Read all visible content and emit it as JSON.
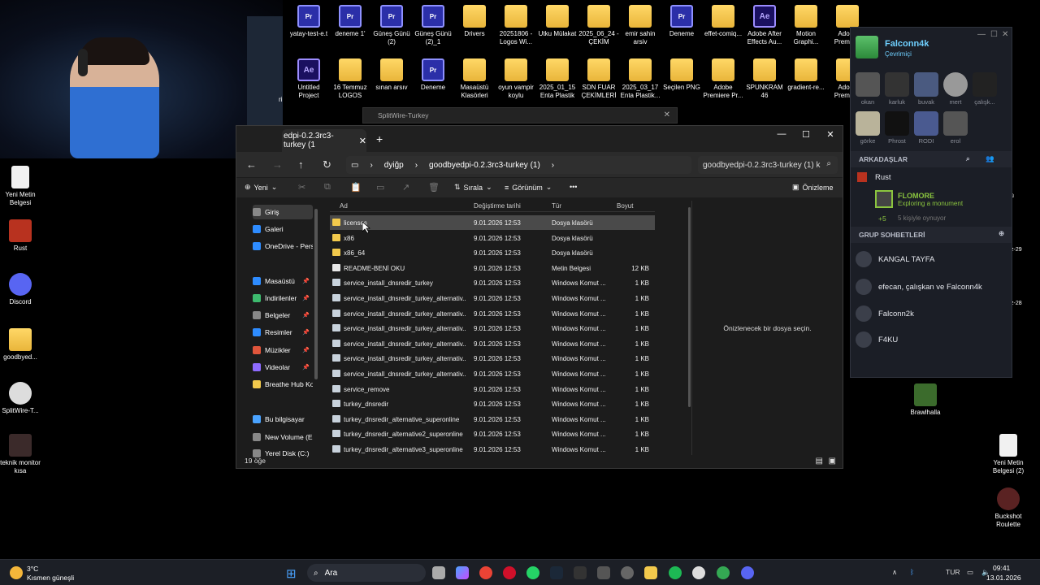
{
  "colors": {
    "folder": "#f2c94c",
    "accent": "#4aa3ff",
    "steam_bg": "#1b1e26",
    "discord": "#5865f2",
    "selected_row": "#4a4a4a"
  },
  "desktop_left": [
    {
      "label": "Yeni Metin Belgesi",
      "icon": "text-doc-icon"
    },
    {
      "label": "Rust",
      "icon": "rust-icon"
    },
    {
      "label": "Discord",
      "icon": "discord-icon"
    },
    {
      "label": "goodbyed...",
      "icon": "folder-icon"
    },
    {
      "label": "SplitWire-T...",
      "icon": "splitwire-icon"
    },
    {
      "label": "teknik monitor kısa",
      "icon": "video-icon"
    }
  ],
  "desktop_top_row1": [
    "yatay-test-e.t",
    "deneme 1'",
    "Güneş Günü (2)",
    "Güneş Günü (2)_1",
    "Drivers",
    "20251806 -Logos Wi...",
    "Utku Mülakat",
    "2025_06_24 - ÇEKİM",
    "emir sahin arsiv",
    "Deneme",
    "effet-comiq...",
    "Adobe After Effects Au...",
    "Motion Graphi...",
    "Adobe Premiere"
  ],
  "desktop_top_row2": [
    "Untitled Project",
    "16 Temmuz LOGOS",
    "sınan arsıv",
    "Deneme",
    "Masaüstü Klasörleri",
    "oyun vampir koylu",
    "2025_01_15 Enta Plastik",
    "SDN FUAR ÇEKİMLERİ",
    "2025_03_17 Enta Plastik...",
    "Seçilen PNG",
    "Adobe Premiere Pr...",
    "SPUNKRAM 46",
    "gradient-re...",
    "Adobe Premiere"
  ],
  "desktop_right": [
    {
      "label": "Brawlhalla"
    },
    {
      "label": "Yeni Metin Belgesi (2)"
    },
    {
      "label": "Buckshot Roulette"
    }
  ],
  "right_edge_labels": [
    "ü",
    "z-29",
    "z-28"
  ],
  "partial_label": "ri",
  "splitwire": {
    "title": "SplitWire-Turkey"
  },
  "explorer": {
    "tab_title": "edpi-0.2.3rc3-turkey (1",
    "tab_close": "✕",
    "new_tab": "+",
    "breadcrumb": [
      "dyiğp",
      "goodbyedpi-0.2.3rc3-turkey (1)"
    ],
    "search_placeholder": "goodbyedpi-0.2.3rc3-turkey (1) k",
    "toolbar": {
      "new": "Yeni",
      "sort": "Sırala",
      "view": "Görünüm",
      "more": "•••",
      "preview": "Önizleme"
    },
    "sidebar": [
      {
        "label": "Giriş",
        "pin": ""
      },
      {
        "label": "Galeri",
        "pin": ""
      },
      {
        "label": "OneDrive - Perso",
        "pin": ""
      },
      {
        "label": "Masaüstü",
        "pin": "📌"
      },
      {
        "label": "İndirilenler",
        "pin": "📌"
      },
      {
        "label": "Belgeler",
        "pin": "📌"
      },
      {
        "label": "Resimler",
        "pin": "📌"
      },
      {
        "label": "Müzikler",
        "pin": "📌"
      },
      {
        "label": "Videolar",
        "pin": "📌"
      },
      {
        "label": "Breathe Hub Koı",
        "pin": ""
      },
      {
        "label": "Bu bilgisayar",
        "pin": ""
      },
      {
        "label": "New Volume (E",
        "pin": ""
      },
      {
        "label": "Yerel Disk (C:)",
        "pin": ""
      }
    ],
    "columns": [
      "Ad",
      "Değiştirme tarihi",
      "Tür",
      "Boyut"
    ],
    "files": [
      {
        "name": "licenses",
        "date": "9.01.2026 12:53",
        "type": "Dosya klasörü",
        "size": "",
        "kind": "folder"
      },
      {
        "name": "x86",
        "date": "9.01.2026 12:53",
        "type": "Dosya klasörü",
        "size": "",
        "kind": "folder"
      },
      {
        "name": "x86_64",
        "date": "9.01.2026 12:53",
        "type": "Dosya klasörü",
        "size": "",
        "kind": "folder"
      },
      {
        "name": "README-BENİ OKU",
        "date": "9.01.2026 12:53",
        "type": "Metin Belgesi",
        "size": "12 KB",
        "kind": "text"
      },
      {
        "name": "service_install_dnsredir_turkey",
        "date": "9.01.2026 12:53",
        "type": "Windows Komut ...",
        "size": "1 KB",
        "kind": "cmd"
      },
      {
        "name": "service_install_dnsredir_turkey_alternativ...",
        "date": "9.01.2026 12:53",
        "type": "Windows Komut ...",
        "size": "1 KB",
        "kind": "cmd"
      },
      {
        "name": "service_install_dnsredir_turkey_alternativ...",
        "date": "9.01.2026 12:53",
        "type": "Windows Komut ...",
        "size": "1 KB",
        "kind": "cmd"
      },
      {
        "name": "service_install_dnsredir_turkey_alternativ...",
        "date": "9.01.2026 12:53",
        "type": "Windows Komut ...",
        "size": "1 KB",
        "kind": "cmd"
      },
      {
        "name": "service_install_dnsredir_turkey_alternativ...",
        "date": "9.01.2026 12:53",
        "type": "Windows Komut ...",
        "size": "1 KB",
        "kind": "cmd"
      },
      {
        "name": "service_install_dnsredir_turkey_alternativ...",
        "date": "9.01.2026 12:53",
        "type": "Windows Komut ...",
        "size": "1 KB",
        "kind": "cmd"
      },
      {
        "name": "service_install_dnsredir_turkey_alternativ...",
        "date": "9.01.2026 12:53",
        "type": "Windows Komut ...",
        "size": "1 KB",
        "kind": "cmd"
      },
      {
        "name": "service_remove",
        "date": "9.01.2026 12:53",
        "type": "Windows Komut ...",
        "size": "1 KB",
        "kind": "cmd"
      },
      {
        "name": "turkey_dnsredir",
        "date": "9.01.2026 12:53",
        "type": "Windows Komut ...",
        "size": "1 KB",
        "kind": "cmd"
      },
      {
        "name": "turkey_dnsredir_alternative_superonline",
        "date": "9.01.2026 12:53",
        "type": "Windows Komut ...",
        "size": "1 KB",
        "kind": "cmd"
      },
      {
        "name": "turkey_dnsredir_alternative2_superonline",
        "date": "9.01.2026 12:53",
        "type": "Windows Komut ...",
        "size": "1 KB",
        "kind": "cmd"
      },
      {
        "name": "turkey_dnsredir_alternative3_superonline",
        "date": "9.01.2026 12:53",
        "type": "Windows Komut ...",
        "size": "1 KB",
        "kind": "cmd"
      }
    ],
    "preview_text": "Önizlenecek bir dosya seçin.",
    "status": "19 öğe"
  },
  "steam": {
    "username": "Falconn4k",
    "status": "Çevrimiçi",
    "friends_avatars": [
      "okan",
      "karluk",
      "buvak",
      "mert",
      "çalışk...",
      "görke",
      "Phrost",
      "RODI",
      "erol"
    ],
    "friends_header": "ARKADAŞLAR",
    "game_group": "Rust",
    "friend_name": "FLOMORE",
    "friend_activity": "Exploring a monument",
    "more_count": "+5",
    "more_text": "5 kişiyle oynuyor",
    "groups_header": "GRUP SOHBETLERİ",
    "groups": [
      "KANGAL TAYFA",
      "efecan, çalışkan ve Falconn4k",
      "Falconn2k",
      "F4KU"
    ]
  },
  "taskbar": {
    "weather_temp": "3°C",
    "weather_text": "Kısmen güneşli",
    "search": "Ara",
    "lang": "TUR",
    "time": "09:41",
    "date": "13.01.2026"
  }
}
